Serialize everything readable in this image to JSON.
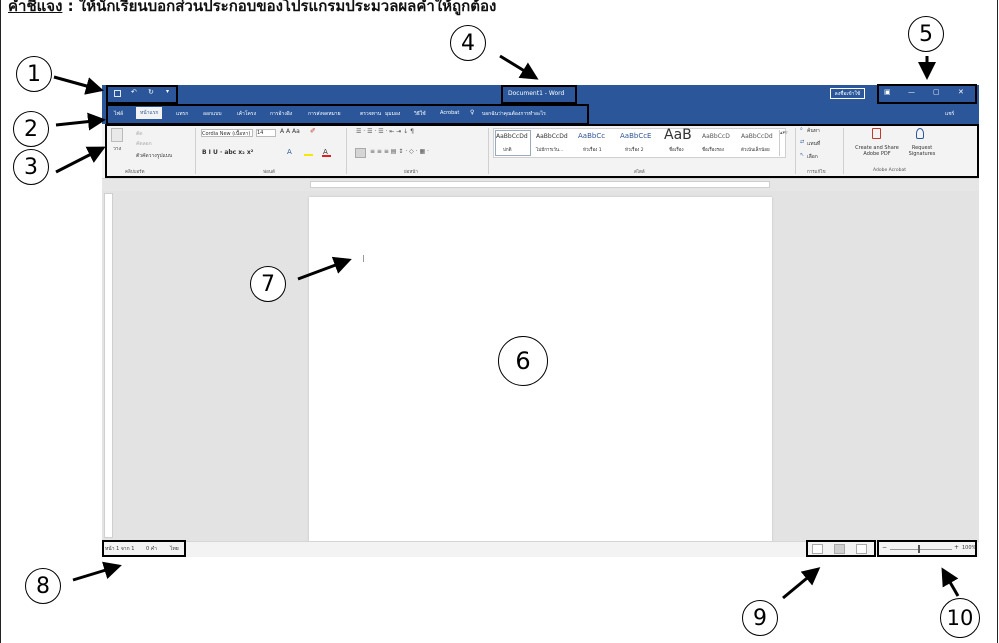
{
  "instruction": {
    "label": "คำชี้แจง",
    "text": " : ให้นักเรียนบอกส่วนประกอบของโปรแกรมประมวลผลคำให้ถูกต้อง"
  },
  "window": {
    "title": "Document1 - Word",
    "signin": "ลงชื่อเข้าใช้",
    "minimize": "—",
    "restore": "▢",
    "close": "✕"
  },
  "tabs": [
    "ไฟล์",
    "หน้าแรก",
    "แทรก",
    "ออกแบบ",
    "เค้าโครง",
    "การอ้างอิง",
    "การส่งจดหมาย",
    "ตรวจทาน",
    "มุมมอง",
    "วิธีใช้",
    "Acrobat",
    "บอกฉันว่าคุณต้องการทำอะไร"
  ],
  "share": "แชร์",
  "ribbon": {
    "paste": "วาง",
    "cut": "ตัด",
    "copy": "คัดลอก",
    "format_painter": "ตัวคัดวางรูปแบบ",
    "font_name": "Cordia New (เนื้อหา)",
    "font_size": "14",
    "styles": [
      {
        "sample": "AaBbCcDd",
        "label": "ปกติ"
      },
      {
        "sample": "AaBbCcDd",
        "label": "ไม่มีการเว้น..."
      },
      {
        "sample": "AaBbCc",
        "label": "หัวเรื่อง 1"
      },
      {
        "sample": "AaBbCcE",
        "label": "หัวเรื่อง 2"
      },
      {
        "sample": "AaB",
        "label": "ชื่อเรื่อง"
      },
      {
        "sample": "AaBbCcD",
        "label": "ชื่อเรื่องรอง"
      },
      {
        "sample": "AaBbCcDd",
        "label": "ตัวเน้นเล็กน้อย"
      }
    ],
    "find": "ค้นหา",
    "replace": "แทนที่",
    "select": "เลือก",
    "create_pdf": "Create and Share Adobe PDF",
    "request_sig": "Request Signatures",
    "groups": {
      "clipboard": "คลิปบอร์ด",
      "font": "ฟอนต์",
      "paragraph": "ย่อหน้า",
      "styles": "สไตล์",
      "editing": "การแก้ไข",
      "acrobat": "Adobe Acrobat"
    }
  },
  "status": {
    "page": "หน้า 1 จาก 1",
    "words": "0 คำ",
    "language": "ไทย",
    "zoom": "100%"
  },
  "callouts": [
    "1",
    "2",
    "3",
    "4",
    "5",
    "6",
    "7",
    "8",
    "9",
    "10"
  ]
}
